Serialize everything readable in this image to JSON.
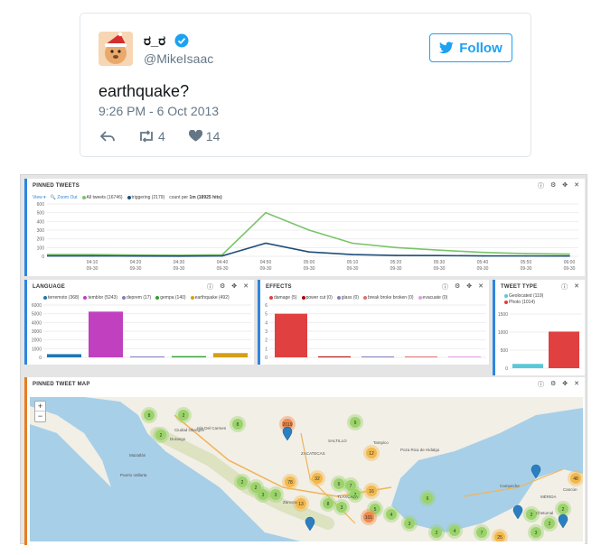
{
  "tweet": {
    "display_name": "ರ_ರ",
    "handle": "@MikeIsaac",
    "follow_label": "Follow",
    "text": "earthquake?",
    "timestamp": "9:26 PM - 6 Oct 2013",
    "retweets": "4",
    "likes": "14",
    "brand_color": "#1da1f2"
  },
  "dashboard": {
    "pinned_tweets": {
      "title": "PINNED TWEETS",
      "view_label": "View ▾",
      "zoom_out_label": "Zoom Out",
      "legend_all": "All tweets (16746)",
      "legend_triggering": "triggering (2179)",
      "legend_count": "count per",
      "legend_interval": "1m",
      "legend_hits": "(18925 hits)",
      "y_ticks": [
        "600",
        "500",
        "400",
        "300",
        "200",
        "100",
        "0"
      ],
      "x_ticks": [
        {
          "time": "04:10",
          "date": "09-30"
        },
        {
          "time": "04:20",
          "date": "09-30"
        },
        {
          "time": "04:30",
          "date": "09-30"
        },
        {
          "time": "04:40",
          "date": "09-30"
        },
        {
          "time": "04:50",
          "date": "09-30"
        },
        {
          "time": "05:00",
          "date": "09-30"
        },
        {
          "time": "05:10",
          "date": "09-30"
        },
        {
          "time": "05:20",
          "date": "09-30"
        },
        {
          "time": "05:30",
          "date": "09-30"
        },
        {
          "time": "05:40",
          "date": "09-30"
        },
        {
          "time": "05:50",
          "date": "09-30"
        },
        {
          "time": "06:00",
          "date": "09-30"
        }
      ],
      "colors": {
        "all": "#7ac36a",
        "triggering": "#1f4e79"
      }
    },
    "language": {
      "title": "LANGUAGE",
      "legend": [
        {
          "label": "terremoto (368)",
          "color": "#1f77b4"
        },
        {
          "label": "temblor (5243)",
          "color": "#c040c0"
        },
        {
          "label": "deprem (17)",
          "color": "#7f7fbf"
        },
        {
          "label": "gempa (140)",
          "color": "#2ca02c"
        },
        {
          "label": "earthquake (492)",
          "color": "#d4a017"
        }
      ],
      "y_ticks": [
        "6000",
        "5000",
        "4000",
        "3000",
        "2000",
        "1000",
        "0"
      ]
    },
    "effects": {
      "title": "EFFECTS",
      "legend": [
        {
          "label": "damage (5)",
          "color": "#e04040"
        },
        {
          "label": "power cut (0)",
          "color": "#b00000"
        },
        {
          "label": "glass (0)",
          "color": "#7f7fbf"
        },
        {
          "label": "break broke broken (0)",
          "color": "#e07070"
        },
        {
          "label": "evacuate (0)",
          "color": "#e0a0e0"
        }
      ],
      "y_ticks": [
        "6",
        "5",
        "4",
        "3",
        "2",
        "1",
        "0"
      ]
    },
    "tweet_type": {
      "title": "TWEET TYPE",
      "legend": [
        {
          "label": "Geolocated (119)",
          "color": "#5bc8d8"
        },
        {
          "label": "Photo (1014)",
          "color": "#e04040"
        }
      ],
      "y_ticks": [
        "1500",
        "1000",
        "500",
        "0"
      ]
    },
    "map": {
      "title": "PINNED TWEET MAP",
      "zoom_in": "+",
      "zoom_out": "−",
      "place_labels": [
        "Durango",
        "Ciudad Obregón",
        "Isla Del Carmen",
        "Mazatlán",
        "Tampico",
        "Poza Rica de Hidalgo",
        "Puerto Vallarta",
        "TLAXCALA",
        "Campeche",
        "MÉRIDA",
        "Cancún",
        "Chetumal",
        "ZACATECAS",
        "SALTILLO",
        "Zamora"
      ],
      "cluster_values": [
        "8",
        "2",
        "2",
        "8",
        "9",
        "12",
        "2",
        "2",
        "3",
        "7",
        "78",
        "32",
        "6",
        "13",
        "3",
        "8",
        "3",
        "7",
        "16",
        "5",
        "4",
        "3",
        "6",
        "2",
        "4",
        "7",
        "25",
        "3",
        "2",
        "48",
        "2",
        "2",
        "2019",
        "101"
      ]
    }
  },
  "chart_data": [
    {
      "type": "line",
      "title": "PINNED TWEETS",
      "x": [
        "04:10",
        "04:20",
        "04:30",
        "04:40",
        "04:50",
        "05:00",
        "05:10",
        "05:20",
        "05:30",
        "05:40",
        "05:50",
        "06:00"
      ],
      "series": [
        {
          "name": "All tweets (16746)",
          "values": [
            20,
            15,
            12,
            18,
            500,
            300,
            150,
            100,
            70,
            45,
            30,
            25
          ]
        },
        {
          "name": "triggering (2179)",
          "values": [
            5,
            3,
            2,
            5,
            150,
            50,
            20,
            10,
            8,
            5,
            4,
            3
          ]
        }
      ],
      "ylim": [
        0,
        600
      ]
    },
    {
      "type": "bar",
      "title": "LANGUAGE",
      "categories": [
        "terremoto (368)",
        "temblor (5243)",
        "deprem (17)",
        "gempa (140)",
        "earthquake (492)"
      ],
      "values": [
        368,
        5243,
        17,
        140,
        492
      ],
      "ylim": [
        0,
        6000
      ]
    },
    {
      "type": "bar",
      "title": "EFFECTS",
      "categories": [
        "damage (5)",
        "power cut (0)",
        "glass (0)",
        "break broke broken (0)",
        "evacuate (0)"
      ],
      "values": [
        5,
        0,
        0,
        0,
        0
      ],
      "ylim": [
        0,
        6
      ]
    },
    {
      "type": "bar",
      "title": "TWEET TYPE",
      "categories": [
        "Geolocated (119)",
        "Photo (1014)"
      ],
      "values": [
        119,
        1014
      ],
      "ylim": [
        0,
        1500
      ]
    }
  ]
}
